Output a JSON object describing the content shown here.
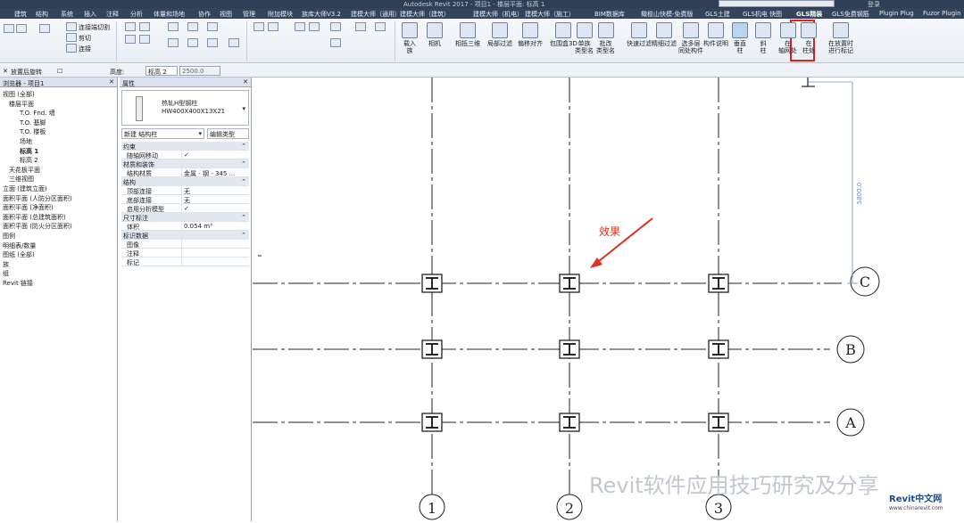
{
  "window": {
    "title": "Autodesk Revit 2017 -   项目1 - 楼层平面: 标高 1",
    "user": "登录"
  },
  "menu_tabs": [
    "建筑",
    "结构",
    "系统",
    "插入",
    "注释",
    "分析",
    "体量和场地",
    "协作",
    "视图",
    "管理",
    "附加模块",
    "族库大师V3.2",
    "建模大师（通用）",
    "建模大师（建筑）",
    "建模大师（机电）",
    "建模大师（施工）",
    "BIM数据库",
    "橄榄山快模-免费版",
    "GLS土建",
    "GLS机电",
    "快图",
    "GLS精装",
    "GLS免费钢筋",
    "Plugin Plug",
    "Fuzor Plugin"
  ],
  "active_tab": "GLS精装",
  "ribbon": {
    "buttons": [
      {
        "label": "载入\n族"
      },
      {
        "label": "相机"
      },
      {
        "label": "相抵三维"
      },
      {
        "label": "局部过滤"
      },
      {
        "label": "偏移对齐"
      },
      {
        "label": "包围盒3D"
      },
      {
        "label": "单族\n类型名"
      },
      {
        "label": "批改\n类型名"
      },
      {
        "label": "快速过滤"
      },
      {
        "label": "精细过滤"
      },
      {
        "label": "选多层\n同处构件"
      },
      {
        "label": "构件说明"
      },
      {
        "label": "垂直\n柱"
      },
      {
        "label": "斜\n柱"
      },
      {
        "label": "在\n轴网处"
      },
      {
        "label": "在\n柱处"
      },
      {
        "label": "在放置时\n进行标记"
      }
    ],
    "small": [
      "连接端切割",
      "剪切",
      "连接"
    ]
  },
  "options_bar": {
    "rotate_label": "放置后旋转",
    "height_label": "高度:",
    "level": "标高 2",
    "value": "2500.0"
  },
  "browser": {
    "title": "浏览器 - 项目1",
    "items": [
      "视图 (全部)",
      "楼层平面",
      "T.O. Fnd. 墙",
      "T.O. 基脚",
      "T.O. 楼板",
      "场地",
      "标高 1",
      "标高 2",
      "天花板平面",
      "三维视图",
      "立面 (建筑立面)",
      "面积平面 (人防分区面积)",
      "面积平面 (净面积)",
      "面积平面 (总建筑面积)",
      "面积平面 (防火分区面积)",
      "图例",
      "明细表/数量",
      "图纸 (全部)",
      "族",
      "组",
      "Revit 链接"
    ]
  },
  "properties": {
    "title": "属性",
    "type_name": "热轧H型钢柱",
    "type_size": "HW400X400X13X21",
    "instance_dropdown": "新建 结构柱",
    "edit_type": "编辑类型",
    "rows": [
      {
        "cat": true,
        "label": "约束"
      },
      {
        "label": "随轴网移动",
        "value": "✓"
      },
      {
        "cat": true,
        "label": "材质和装饰"
      },
      {
        "label": "结构材质",
        "value": "金属 - 钢 - 345 ..."
      },
      {
        "cat": true,
        "label": "结构"
      },
      {
        "label": "顶部连接",
        "value": "无"
      },
      {
        "label": "底部连接",
        "value": "无"
      },
      {
        "label": "启用分析模型",
        "value": "✓"
      },
      {
        "cat": true,
        "label": "尺寸标注"
      },
      {
        "label": "体积",
        "value": "0.054 m³"
      },
      {
        "cat": true,
        "label": "标识数据"
      },
      {
        "label": "图像",
        "value": ""
      },
      {
        "label": "注释",
        "value": ""
      },
      {
        "label": "标记",
        "value": ""
      }
    ]
  },
  "canvas": {
    "annotation": "效果",
    "dimension": "5800.0",
    "grids_h": [
      "C",
      "B",
      "A"
    ],
    "grids_v": [
      "1",
      "2",
      "3"
    ]
  },
  "watermark": "Revit软件应用技巧研究及分享",
  "logo": {
    "name": "Revit中文网",
    "url": "www.chinarevit.com"
  },
  "colors": {
    "highlight": "#e02020",
    "annotation": "#e03020"
  }
}
